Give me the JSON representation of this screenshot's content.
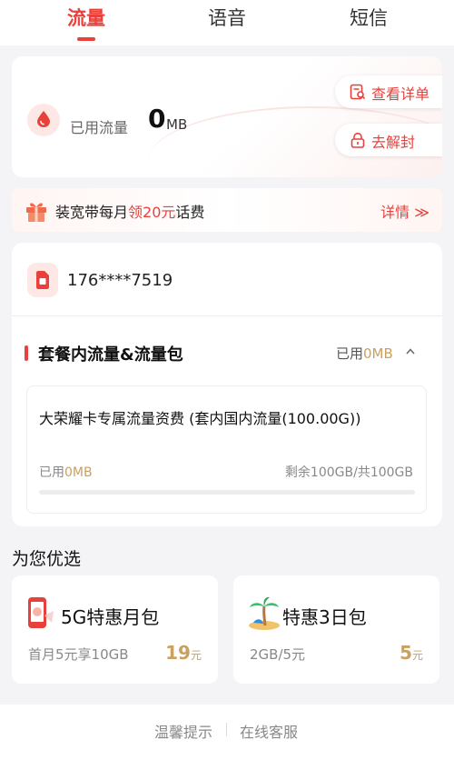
{
  "tabs": [
    {
      "label": "流量",
      "active": true
    },
    {
      "label": "语音",
      "active": false
    },
    {
      "label": "短信",
      "active": false
    }
  ],
  "usage": {
    "label": "已用流量",
    "value": "0",
    "unit": "MB",
    "actions": [
      "查看详单",
      "去解封"
    ]
  },
  "promo": {
    "text_before": "装宽带每月",
    "highlight": "领20元",
    "text_after": "话费",
    "link": "详情 ≫"
  },
  "plan": {
    "phone": "176****7519",
    "section_title": "套餐内流量&流量包",
    "section_used_label": "已用",
    "section_used_value": "0MB",
    "item": {
      "name": "大荣耀卡专属流量资费 (套内国内流量(100.00G))",
      "used_label": "已用",
      "used_value": "0MB",
      "remaining": "剩余100GB/共100GB",
      "used_fraction": 0
    }
  },
  "recommend": {
    "title": "为您优选",
    "cards": [
      {
        "name": "5G特惠月包",
        "subtitle": "首月5元享10GB",
        "price": "19",
        "unit": "元",
        "icon": "phone-5g-icon"
      },
      {
        "name": "特惠3日包",
        "subtitle": "2GB/5元",
        "price": "5",
        "unit": "元",
        "icon": "beach-icon"
      }
    ]
  },
  "footer": {
    "links": [
      "温馨提示",
      "在线客服"
    ]
  },
  "colors": {
    "accent": "#e8413c",
    "gold": "#c9a060",
    "background": "#f4f4f6"
  }
}
